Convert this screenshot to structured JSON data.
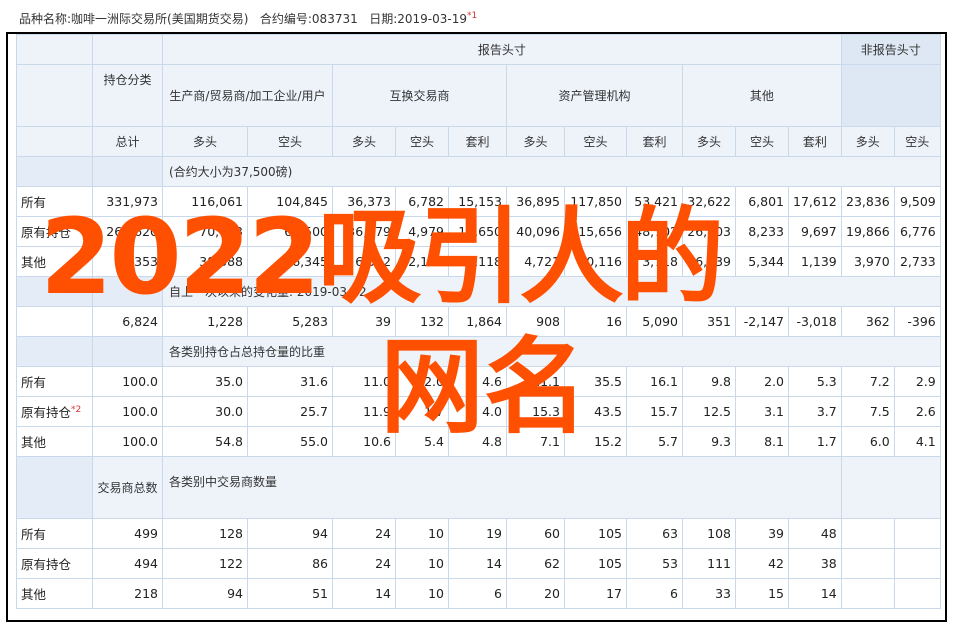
{
  "title_bar": {
    "product_label": "品种名称:",
    "product_value": "咖啡一洲际交易所(美国期货交易)",
    "contract_label": "合约编号:",
    "contract_value": "083731",
    "date_label": "日期:",
    "date_value": "2019-03-19",
    "footnote_mark": "*1"
  },
  "table": {
    "group_reportable": "报告头寸",
    "group_nonreportable": "非报告头寸",
    "col_position_type": "持仓分类",
    "sub_producer": "生产商/贸易商/加工企业/用户",
    "sub_swap": "互换交易商",
    "sub_managed": "资产管理机构",
    "sub_other": "其他",
    "col_total": "总计",
    "long": "多头",
    "short": "空头",
    "spread": "套利",
    "note_contract_size": "(合约大小为37,500磅)",
    "note_change": "自上一次以来的变化量: 2019-03-12",
    "note_share": "各类别持仓占总持仓量的比重",
    "col_traders_total": "交易商总数",
    "note_traders": "各类别中交易商数量",
    "footnote_mark2": "*2",
    "rows_positions": [
      {
        "label": "所有",
        "cells": [
          "331,973",
          "116,061",
          "104,845",
          "36,373",
          "6,782",
          "15,153",
          "36,895",
          "117,850",
          "53,421",
          "32,622",
          "6,801",
          "17,612",
          "23,836",
          "9,509"
        ]
      },
      {
        "label": "原有持仓",
        "cells": [
          "262,620",
          "70,673",
          "68,500",
          "36,579",
          "4,979",
          "10,650",
          "40,096",
          "115,656",
          "48,702",
          "26,203",
          "8,233",
          "9,697",
          "19,866",
          "6,776"
        ]
      },
      {
        "label": "其他",
        "cells": [
          "35,353",
          "38,388",
          "36,345",
          "6,312",
          "2,193",
          "3,118",
          "4,721",
          "10,116",
          "3,718",
          "6,139",
          "5,344",
          "1,139",
          "3,970",
          "2,733"
        ]
      }
    ],
    "row_change": [
      "6,824",
      "1,228",
      "5,283",
      "39",
      "132",
      "1,864",
      "908",
      "16",
      "5,090",
      "351",
      "-2,147",
      "-3,018",
      "362",
      "-396"
    ],
    "rows_share": [
      {
        "label": "所有",
        "cells": [
          "100.0",
          "35.0",
          "31.6",
          "11.0",
          "2.0",
          "4.6",
          "11.1",
          "35.5",
          "16.1",
          "9.8",
          "2.0",
          "5.3",
          "7.2",
          "2.9"
        ]
      },
      {
        "label": "原有持仓",
        "cells": [
          "100.0",
          "30.0",
          "25.7",
          "11.9",
          "1.7",
          "4.0",
          "15.3",
          "43.5",
          "15.7",
          "12.5",
          "3.1",
          "3.7",
          "7.5",
          "2.6"
        ]
      },
      {
        "label": "其他",
        "cells": [
          "100.0",
          "54.8",
          "55.0",
          "10.6",
          "5.4",
          "4.8",
          "7.1",
          "15.2",
          "5.7",
          "9.3",
          "8.1",
          "1.7",
          "6.0",
          "4.1"
        ]
      }
    ],
    "rows_traders": [
      {
        "label": "所有",
        "cells": [
          "499",
          "128",
          "94",
          "24",
          "10",
          "19",
          "60",
          "105",
          "63",
          "108",
          "39",
          "48",
          "",
          ""
        ]
      },
      {
        "label": "原有持仓",
        "cells": [
          "494",
          "122",
          "86",
          "24",
          "10",
          "14",
          "62",
          "105",
          "53",
          "111",
          "42",
          "38",
          "",
          ""
        ]
      },
      {
        "label": "其他",
        "cells": [
          "218",
          "94",
          "51",
          "14",
          "10",
          "6",
          "20",
          "17",
          "6",
          "33",
          "15",
          "14",
          "",
          ""
        ]
      }
    ]
  },
  "overlay": {
    "line1": "2022吸引人的",
    "line2": "网名"
  },
  "colors": {
    "overlay_text": "#ff4f00",
    "header_bg": "#eef3fa",
    "border": "#c9d8ea"
  }
}
